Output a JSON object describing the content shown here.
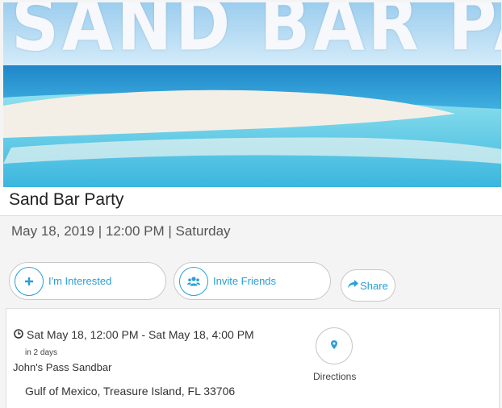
{
  "banner": {
    "text": "SAND BAR PARTY"
  },
  "event": {
    "title": "Sand Bar Party",
    "date_line": "May 18, 2019 | 12:00 PM | Saturday"
  },
  "actions": {
    "interested_label": "I'm Interested",
    "invite_label": "Invite Friends",
    "share_label": "Share"
  },
  "details": {
    "time_range": "Sat May 18, 12:00 PM - Sat May 18, 4:00 PM",
    "relative": "in 2 days",
    "venue": "John's Pass Sandbar",
    "address": "Gulf of Mexico, Treasure Island, FL 33706",
    "directions_label": "Directions"
  },
  "colors": {
    "accent": "#2a9fd6",
    "page_bg": "#f4f4f4"
  },
  "icons": [
    "plus-icon",
    "users-icon",
    "share-icon",
    "clock-icon",
    "map-pin-icon"
  ]
}
